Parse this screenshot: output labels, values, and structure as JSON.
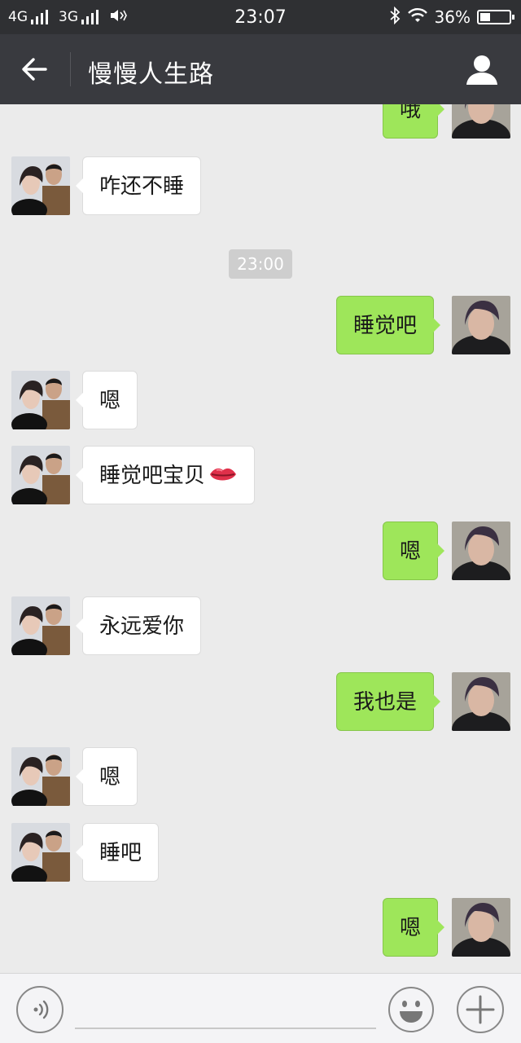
{
  "status_bar": {
    "net1": "4G",
    "net2": "3G",
    "time": "23:07",
    "battery": "36%",
    "battery_level": 0.36
  },
  "header": {
    "title": "慢慢人生路",
    "back_icon": "back-arrow-icon",
    "profile_icon": "person-icon"
  },
  "messages": [
    {
      "side": "out",
      "text": "哦"
    },
    {
      "side": "in",
      "text": "咋还不睡"
    },
    {
      "type": "time",
      "text": "23:00"
    },
    {
      "side": "out",
      "text": "睡觉吧"
    },
    {
      "side": "in",
      "text": "嗯"
    },
    {
      "side": "in",
      "text": "睡觉吧宝贝",
      "emoji": "lips"
    },
    {
      "side": "out",
      "text": "嗯"
    },
    {
      "side": "in",
      "text": "永远爱你"
    },
    {
      "side": "out",
      "text": "我也是"
    },
    {
      "side": "in",
      "text": "嗯"
    },
    {
      "side": "in",
      "text": "睡吧"
    },
    {
      "side": "out",
      "text": "嗯"
    }
  ],
  "input_bar": {
    "voice_icon": "voice-icon",
    "emoji_icon": "smiley-icon",
    "plus_icon": "plus-icon",
    "input_value": ""
  },
  "colors": {
    "status_bar": "#2f3033",
    "title_bar": "#393a3f",
    "chat_bg": "#ebebeb",
    "outgoing_bubble": "#9ee65a",
    "incoming_bubble": "#ffffff"
  }
}
